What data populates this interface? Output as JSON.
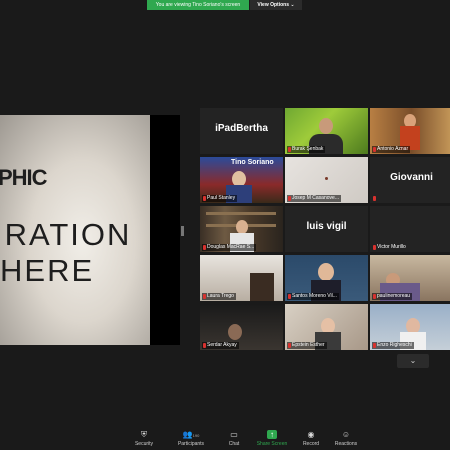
{
  "banner": {
    "viewing_text": "You are viewing Tino Soriano's screen",
    "view_options": "View Options ⌄"
  },
  "shared_screen": {
    "line1": "PHIC",
    "line2": "IRATION",
    "line3": "HERE"
  },
  "participants": [
    {
      "name": "iPadBertha",
      "display": "name"
    },
    {
      "name": "Burak Şenbak",
      "display": "video"
    },
    {
      "name": "Antonio Aznar",
      "display": "video"
    },
    {
      "name": "Paul Stanley",
      "display": "video",
      "overlay": "Tino Soriano"
    },
    {
      "name": "Josep M Casanove...",
      "display": "video"
    },
    {
      "name": "Giovanni",
      "display": "name"
    },
    {
      "name": "Douglas MacRae S...",
      "display": "video"
    },
    {
      "name": "luis vigil",
      "display": "name"
    },
    {
      "name": "Victor Murillo",
      "display": "label-only"
    },
    {
      "name": "Laura Trego",
      "display": "video"
    },
    {
      "name": "Santos Moreno Vil...",
      "display": "video"
    },
    {
      "name": "paulinemoreau",
      "display": "video"
    },
    {
      "name": "Serdar Akyay",
      "display": "video"
    },
    {
      "name": "Epstein Esther",
      "display": "video"
    },
    {
      "name": "Enzo Righeschi",
      "display": "video"
    }
  ],
  "toolbar": {
    "security": "Security",
    "participants": "Participants",
    "participants_count": "190",
    "chat": "Chat",
    "share_screen": "Share Screen",
    "record": "Record",
    "reactions": "Reactions"
  },
  "colors": {
    "accent_green": "#2fa84f",
    "background": "#1a1a1a",
    "mute_red": "#d8322f"
  },
  "icons": {
    "security": "shield-icon",
    "participants": "people-icon",
    "chat": "chat-bubble-icon",
    "share_screen": "share-up-arrow-icon",
    "record": "record-icon",
    "reactions": "smiley-plus-icon",
    "scroll": "chevron-down-icon"
  }
}
